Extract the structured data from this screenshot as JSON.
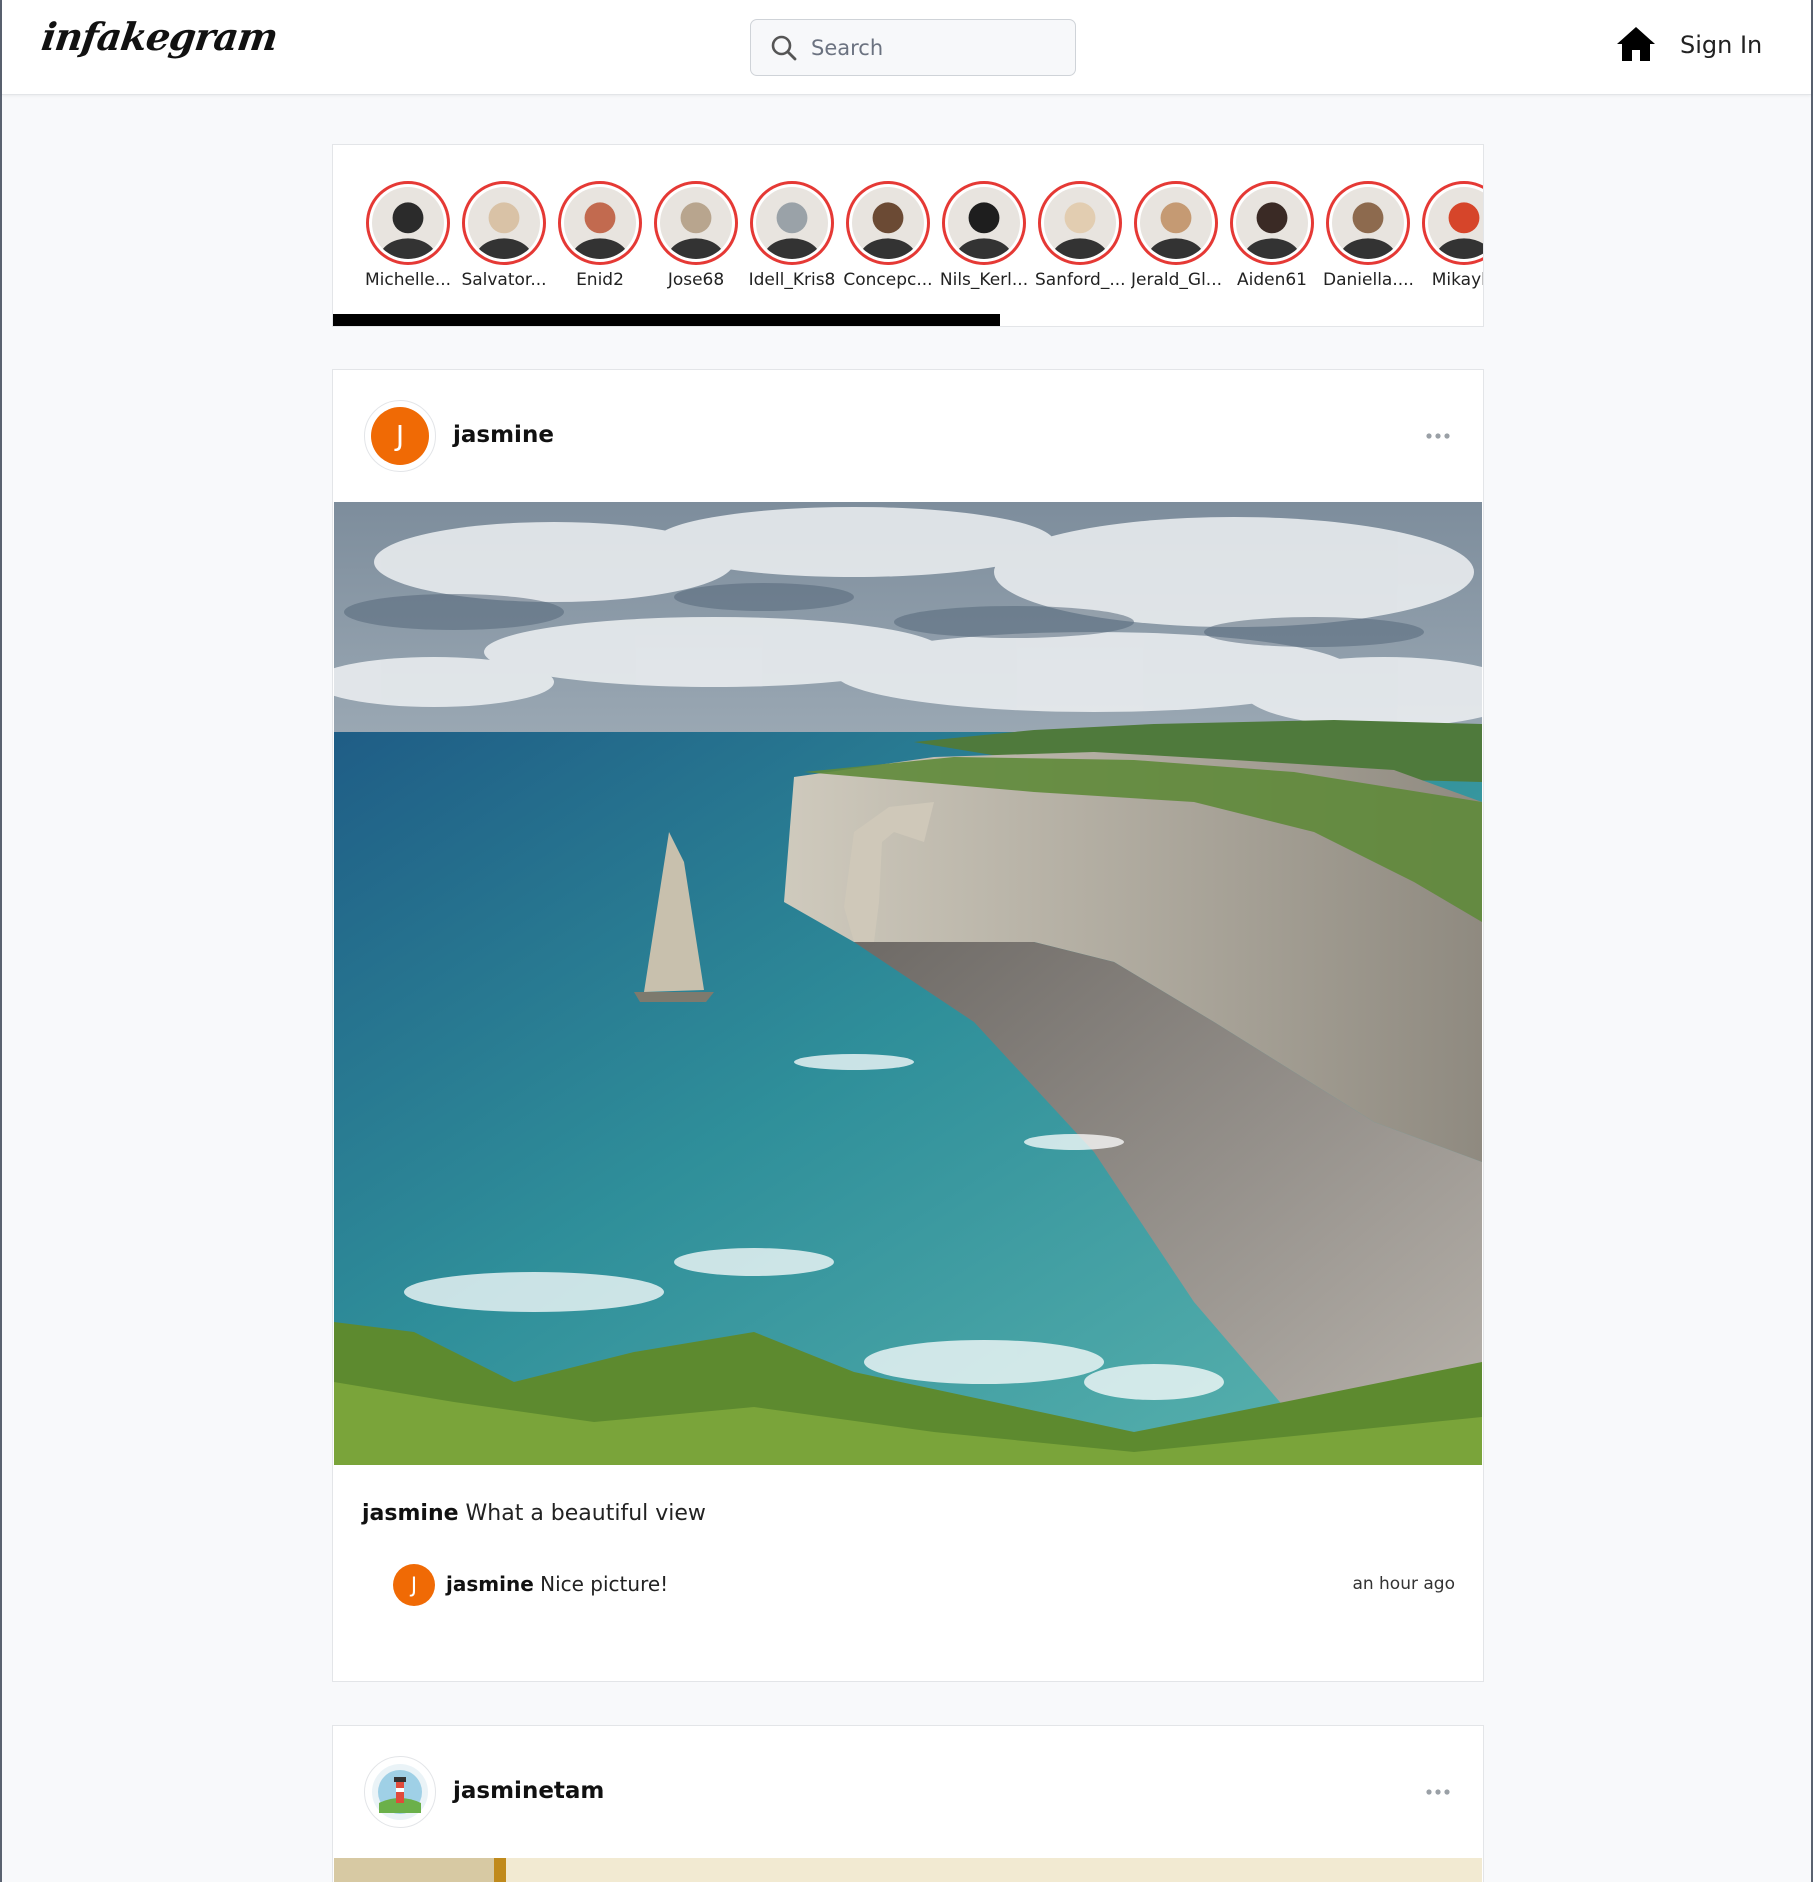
{
  "app": {
    "logo_text": "infakegram"
  },
  "header": {
    "search": {
      "placeholder": "Search",
      "icon": "search-icon"
    },
    "home_icon": "home-icon",
    "signin_label": "Sign In"
  },
  "stories": {
    "items": [
      {
        "name": "Michelle...",
        "tone": "#2b2b2b"
      },
      {
        "name": "Salvator...",
        "tone": "#d9c2a6"
      },
      {
        "name": "Enid2",
        "tone": "#c26a4f"
      },
      {
        "name": "Jose68",
        "tone": "#b8a58e"
      },
      {
        "name": "Idell_Kris8",
        "tone": "#9aa2a8"
      },
      {
        "name": "Concepc...",
        "tone": "#6b4a34"
      },
      {
        "name": "Nils_Kerl...",
        "tone": "#1e1e1e"
      },
      {
        "name": "Sanford_...",
        "tone": "#e2cdb1"
      },
      {
        "name": "Jerald_Gl...",
        "tone": "#c59a73"
      },
      {
        "name": "Aiden61",
        "tone": "#3a2a25"
      },
      {
        "name": "Daniella....",
        "tone": "#8d6a4e"
      },
      {
        "name": "Mikayla",
        "tone": "#d6452a"
      }
    ],
    "scroll_progress": 0.58
  },
  "posts": [
    {
      "username": "jasmine",
      "avatar_letter": "J",
      "avatar_color": "#f06a05",
      "more_icon": "more-dots-icon",
      "image_alt": "coastal cliffs with sea arch",
      "caption_user": "jasmine",
      "caption_text": "What a beautiful view",
      "comments": [
        {
          "avatar_letter": "J",
          "user": "jasmine",
          "text": "Nice picture!",
          "time": "an hour ago"
        }
      ]
    },
    {
      "username": "jasminetam",
      "avatar_icon": "lighthouse-avatar",
      "more_icon": "more-dots-icon"
    }
  ]
}
